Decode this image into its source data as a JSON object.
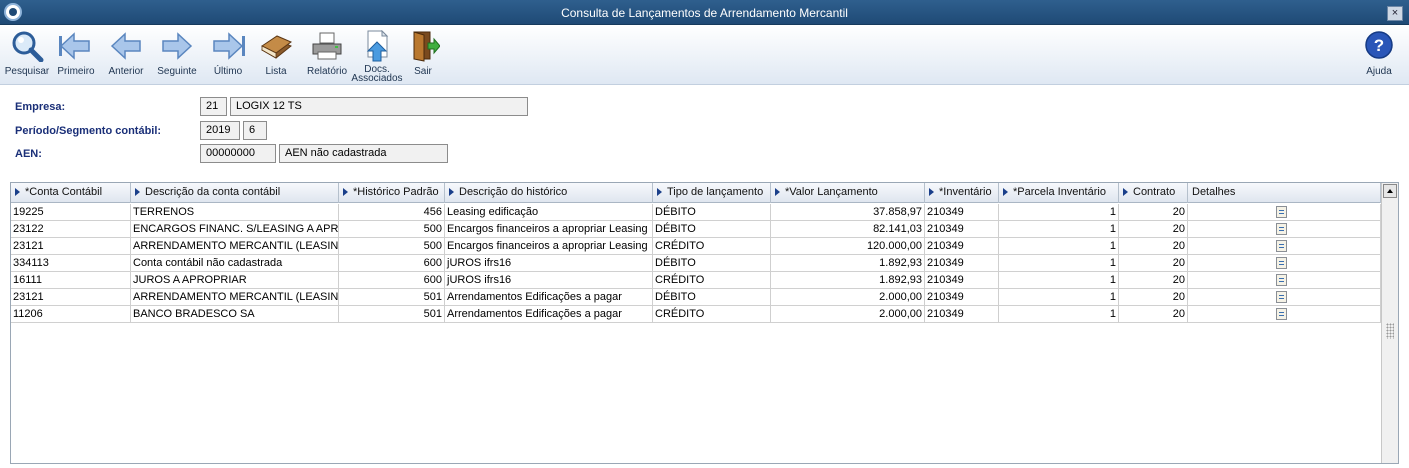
{
  "window": {
    "title": "Consulta de Lançamentos de Arrendamento Mercantil",
    "close_label": "×"
  },
  "toolbar": {
    "buttons": [
      {
        "label": "Pesquisar",
        "icon": "magnifier-icon"
      },
      {
        "label": "Primeiro",
        "icon": "first-arrow-icon"
      },
      {
        "label": "Anterior",
        "icon": "left-arrow-icon"
      },
      {
        "label": "Seguinte",
        "icon": "right-arrow-icon"
      },
      {
        "label": "Último",
        "icon": "last-arrow-icon"
      },
      {
        "label": "Lista",
        "icon": "book-icon"
      },
      {
        "label": "Relatório",
        "icon": "printer-icon"
      },
      {
        "label": "Docs. Associados",
        "icon": "document-upload-icon"
      },
      {
        "label": "Sair",
        "icon": "exit-door-icon"
      }
    ],
    "help_label": "Ajuda",
    "help_icon": "help-icon"
  },
  "form": {
    "empresa": {
      "label": "Empresa:",
      "code": "21",
      "name": "LOGIX 12 TS"
    },
    "periodo": {
      "label": "Período/Segmento contábil:",
      "year": "2019",
      "segment": "6"
    },
    "aen": {
      "label": "AEN:",
      "code": "00000000",
      "name": "AEN não cadastrada"
    }
  },
  "grid": {
    "columns": [
      {
        "label": "*Conta Contábil",
        "sortable": true
      },
      {
        "label": "Descrição da conta contábil",
        "sortable": true
      },
      {
        "label": "*Histórico Padrão",
        "sortable": true
      },
      {
        "label": "Descrição do histórico",
        "sortable": true
      },
      {
        "label": "Tipo de lançamento",
        "sortable": true
      },
      {
        "label": "*Valor Lançamento",
        "sortable": true
      },
      {
        "label": "*Inventário",
        "sortable": true
      },
      {
        "label": "*Parcela Inventário",
        "sortable": true
      },
      {
        "label": "Contrato",
        "sortable": true
      },
      {
        "label": "Detalhes",
        "sortable": false
      }
    ],
    "rows": [
      [
        "19225",
        "TERRENOS",
        "456",
        "Leasing edificação",
        "DÉBITO",
        "37.858,97",
        "210349",
        "1",
        "20"
      ],
      [
        "23122",
        "ENCARGOS FINANC. S/LEASING A APROF",
        "500",
        "Encargos financeiros a apropriar Leasing",
        "DÉBITO",
        "82.141,03",
        "210349",
        "1",
        "20"
      ],
      [
        "23121",
        "ARRENDAMENTO MERCANTIL (LEASING)",
        "500",
        "Encargos financeiros a apropriar Leasing",
        "CRÉDITO",
        "120.000,00",
        "210349",
        "1",
        "20"
      ],
      [
        "334113",
        "Conta contábil não cadastrada",
        "600",
        "jUROS ifrs16",
        "DÉBITO",
        "1.892,93",
        "210349",
        "1",
        "20"
      ],
      [
        "16111",
        "JUROS A APROPRIAR",
        "600",
        "jUROS ifrs16",
        "CRÉDITO",
        "1.892,93",
        "210349",
        "1",
        "20"
      ],
      [
        "23121",
        "ARRENDAMENTO MERCANTIL (LEASING)",
        "501",
        "Arrendamentos Edificações a pagar",
        "DÉBITO",
        "2.000,00",
        "210349",
        "1",
        "20"
      ],
      [
        "11206",
        "BANCO BRADESCO SA",
        "501",
        "Arrendamentos Edificações a pagar",
        "CRÉDITO",
        "2.000,00",
        "210349",
        "1",
        "20"
      ]
    ]
  },
  "colors": {
    "titlebar": "#2f5f8e",
    "label_blue": "#1a2f78",
    "arrow_blue": "#1a3f8a"
  }
}
